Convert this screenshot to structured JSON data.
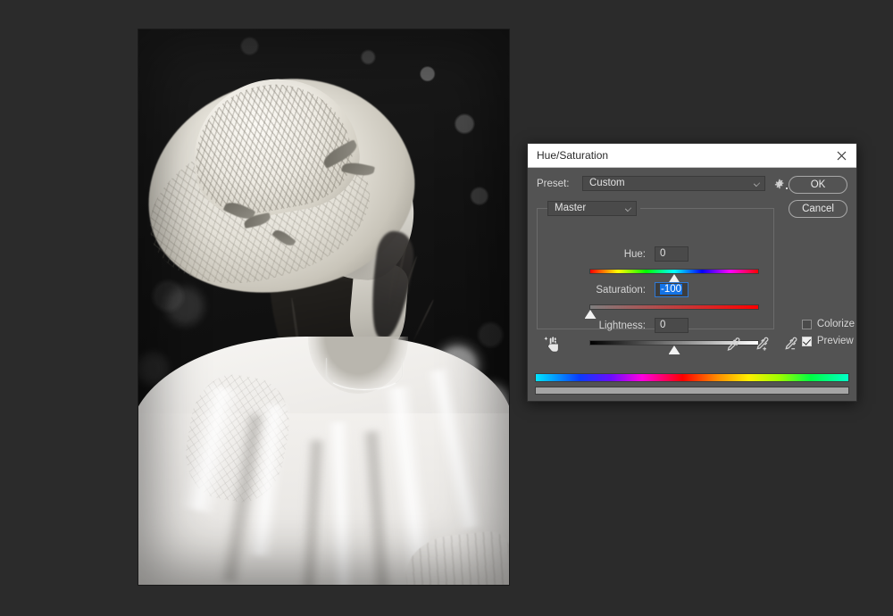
{
  "photo": {
    "alt_description": "Black and white portrait of a young woman wearing a wide-brimmed woven straw sun hat with floral band, in a sheer white blouse, against a blurred bokeh foliage background"
  },
  "dialog": {
    "title": "Hue/Saturation",
    "close_icon": "close-icon",
    "preset": {
      "label": "Preset:",
      "value": "Custom"
    },
    "gear_icon": "gear-icon",
    "buttons": {
      "ok": "OK",
      "cancel": "Cancel"
    },
    "channel": {
      "value": "Master"
    },
    "sliders": [
      {
        "label": "Hue:",
        "value": "0",
        "thumb_percent": 50,
        "focused": false,
        "track": "hue"
      },
      {
        "label": "Saturation:",
        "value": "-100",
        "thumb_percent": 0,
        "focused": true,
        "track": "saturation"
      },
      {
        "label": "Lightness:",
        "value": "0",
        "thumb_percent": 50,
        "focused": false,
        "track": "lightness"
      }
    ],
    "tools": {
      "hand_icon": "on-image-adjustment-hand-icon",
      "eyedroppers": [
        "eyedropper-icon",
        "eyedropper-add-icon",
        "eyedropper-subtract-icon"
      ]
    },
    "checkboxes": [
      {
        "label": "Colorize",
        "checked": false
      },
      {
        "label": "Preview",
        "checked": true
      }
    ],
    "colors": {
      "dialog_background": "#535353",
      "titlebar_background": "#ffffff",
      "field_background": "#4a4a4a",
      "selection_blue": "#1473e6",
      "focus_border": "#2f79d6",
      "text": "#d6d6d6"
    }
  },
  "app": {
    "canvas_background": "#2b2b2b"
  }
}
